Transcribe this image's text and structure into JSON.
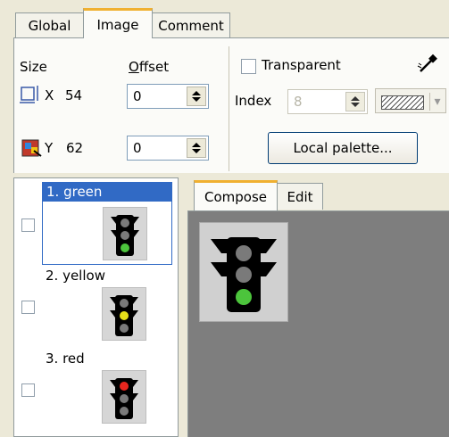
{
  "tabs": [
    {
      "label": "Global",
      "active": false
    },
    {
      "label": "Image",
      "active": true
    },
    {
      "label": "Comment",
      "active": false
    }
  ],
  "size": {
    "label": "Size",
    "x_label": "X",
    "x_value": "54",
    "y_label": "Y",
    "y_value": "62"
  },
  "offset": {
    "label": "Offset",
    "x_value": "0",
    "y_value": "0"
  },
  "transparent": {
    "label": "Transparent",
    "checked": false
  },
  "index": {
    "label": "Index",
    "value": "8",
    "disabled": true
  },
  "local_palette_button": "Local palette...",
  "frames": [
    {
      "label": "1. green",
      "selected": true,
      "checked": false,
      "light": "green"
    },
    {
      "label": "2. yellow",
      "selected": false,
      "checked": false,
      "light": "yellow"
    },
    {
      "label": "3. red",
      "selected": false,
      "checked": false,
      "light": "red"
    }
  ],
  "subtabs": [
    {
      "label": "Compose",
      "active": true
    },
    {
      "label": "Edit",
      "active": false
    }
  ],
  "colors": {
    "green": "#4cc43c",
    "yellow": "#e6e01a",
    "red": "#e8261e",
    "off": "#7a7a7a",
    "selection": "#316ac5",
    "tab_accent": "#f0b030"
  }
}
